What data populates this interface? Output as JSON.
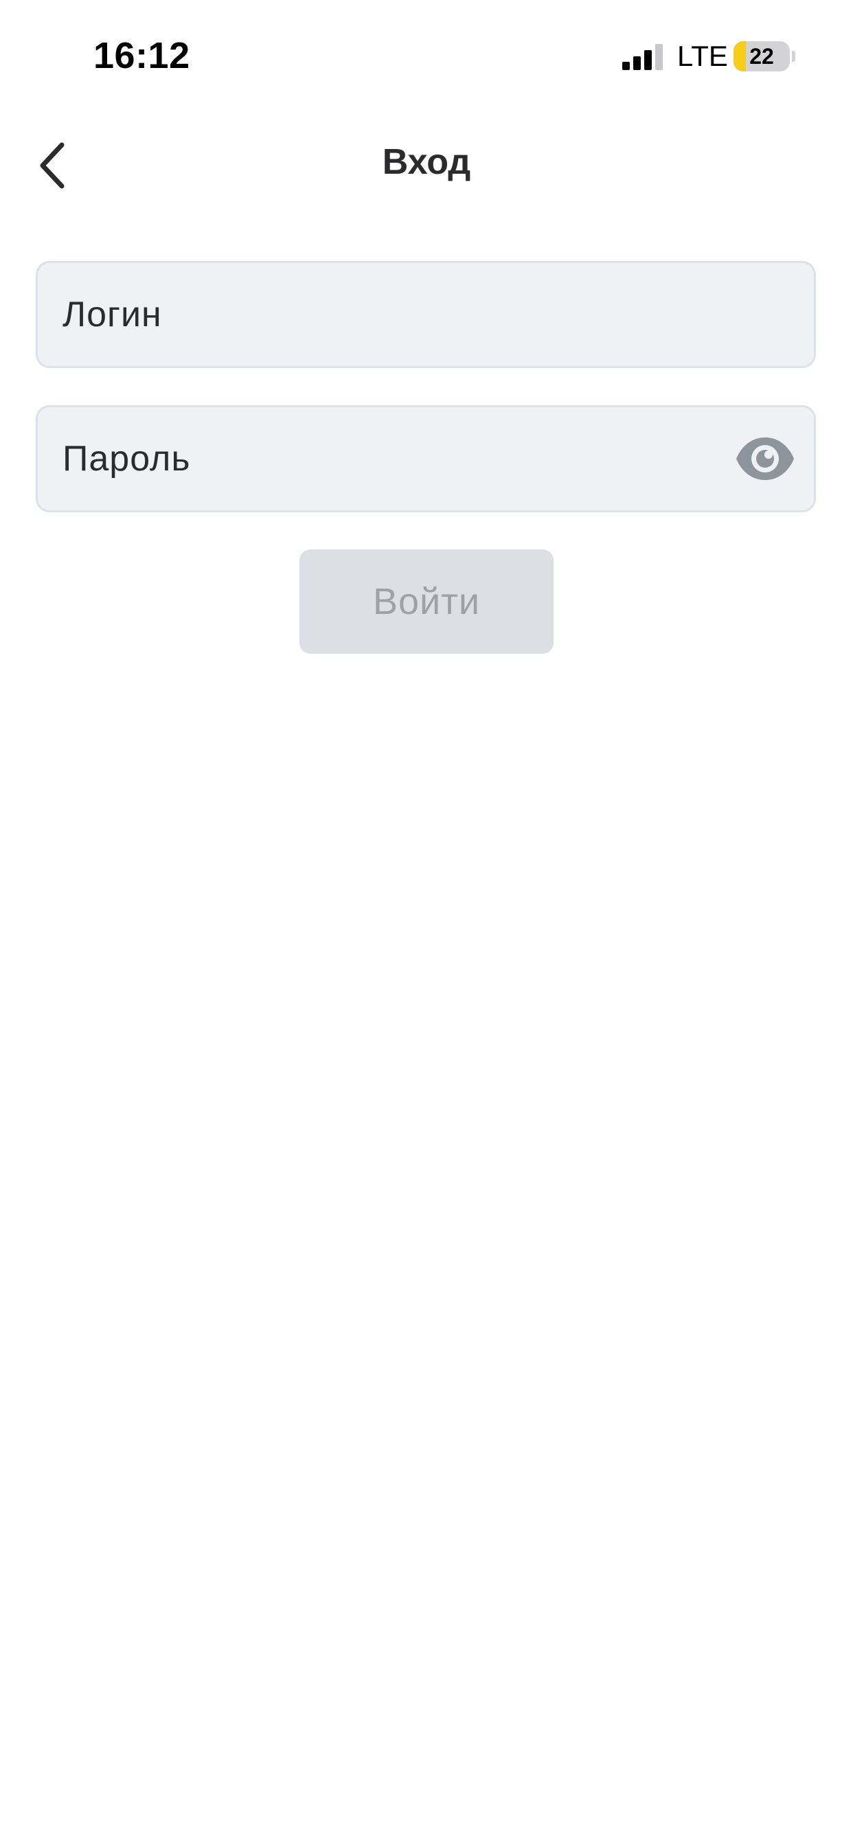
{
  "status_bar": {
    "time": "16:12",
    "network": "LTE",
    "battery_level": "22",
    "signal_icon": "cellular-signal-icon",
    "battery_icon": "battery-icon"
  },
  "nav": {
    "back_icon": "chevron-left-icon",
    "title": "Вход"
  },
  "form": {
    "login_placeholder": "Логин",
    "password_placeholder": "Пароль",
    "password_toggle_icon": "eye-icon",
    "submit_label": "Войти"
  },
  "colors": {
    "field_background": "#f0f1f5",
    "field_border": "#dfe1e8",
    "button_disabled_background": "#dedfe5",
    "button_disabled_text": "#9fa1a8",
    "battery_fill": "#f6cd1b",
    "icon_gray": "#8e949c"
  }
}
